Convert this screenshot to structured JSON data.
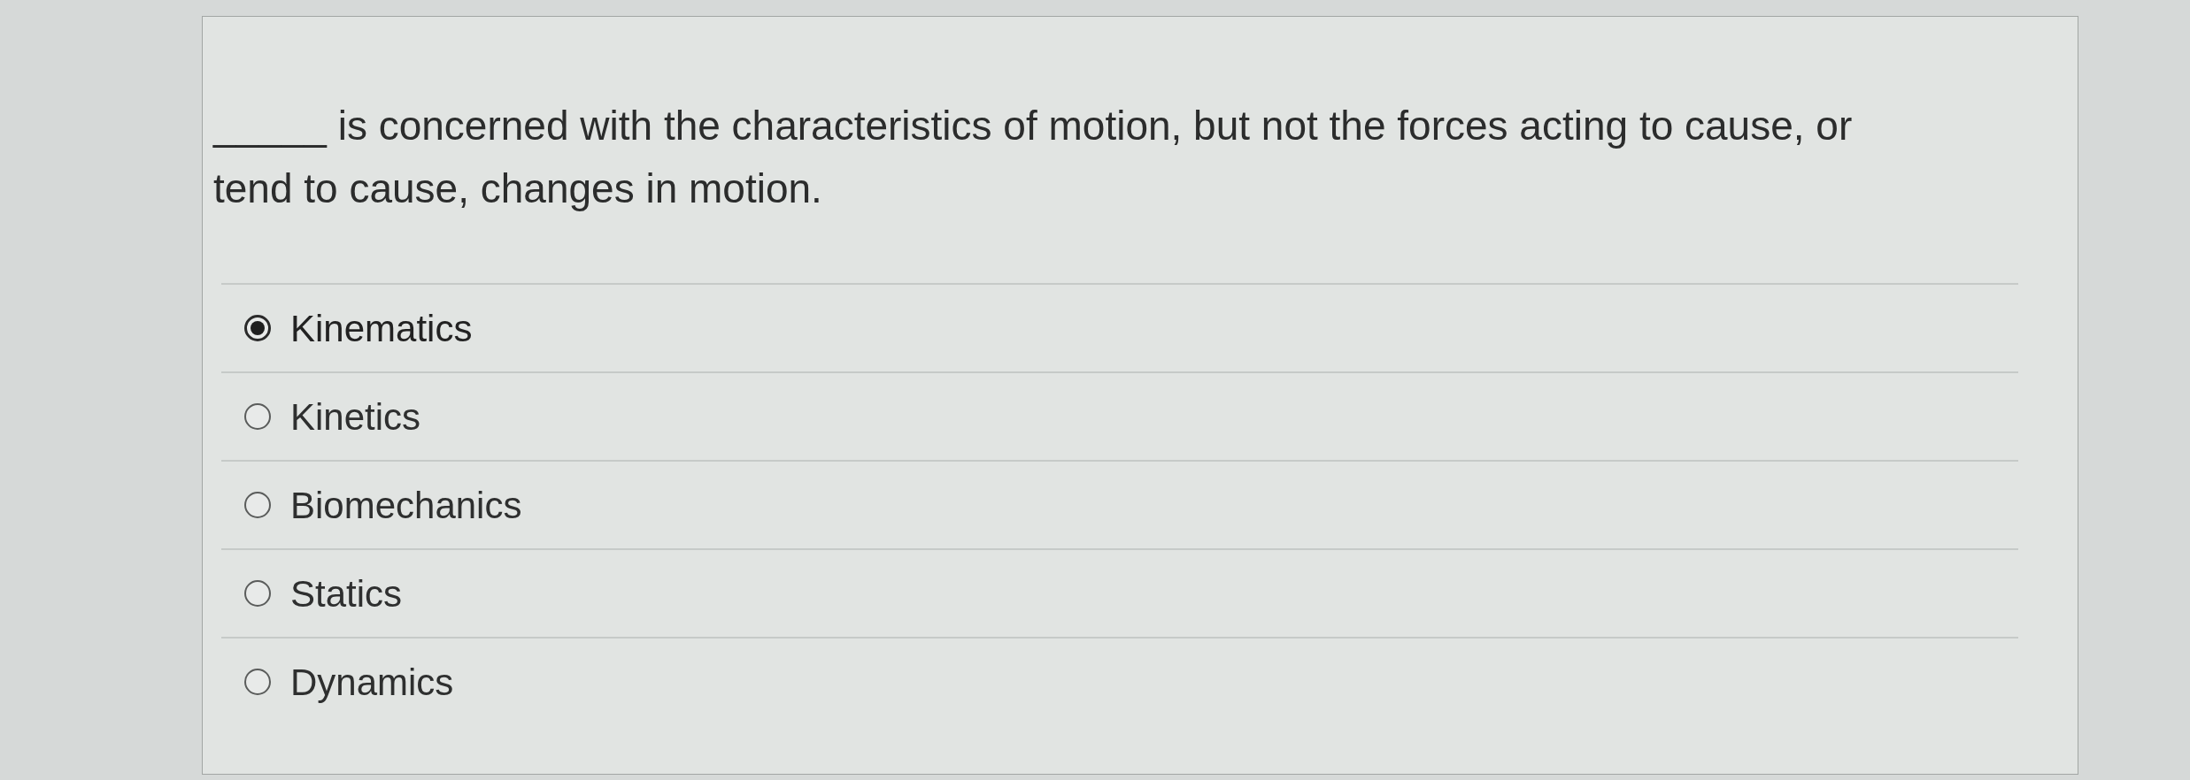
{
  "question": {
    "text": "_____ is concerned with the characteristics of motion, but not the forces acting to cause, or tend to cause, changes in motion."
  },
  "options": [
    {
      "label": "Kinematics",
      "selected": true
    },
    {
      "label": "Kinetics",
      "selected": false
    },
    {
      "label": "Biomechanics",
      "selected": false
    },
    {
      "label": "Statics",
      "selected": false
    },
    {
      "label": "Dynamics",
      "selected": false
    }
  ]
}
